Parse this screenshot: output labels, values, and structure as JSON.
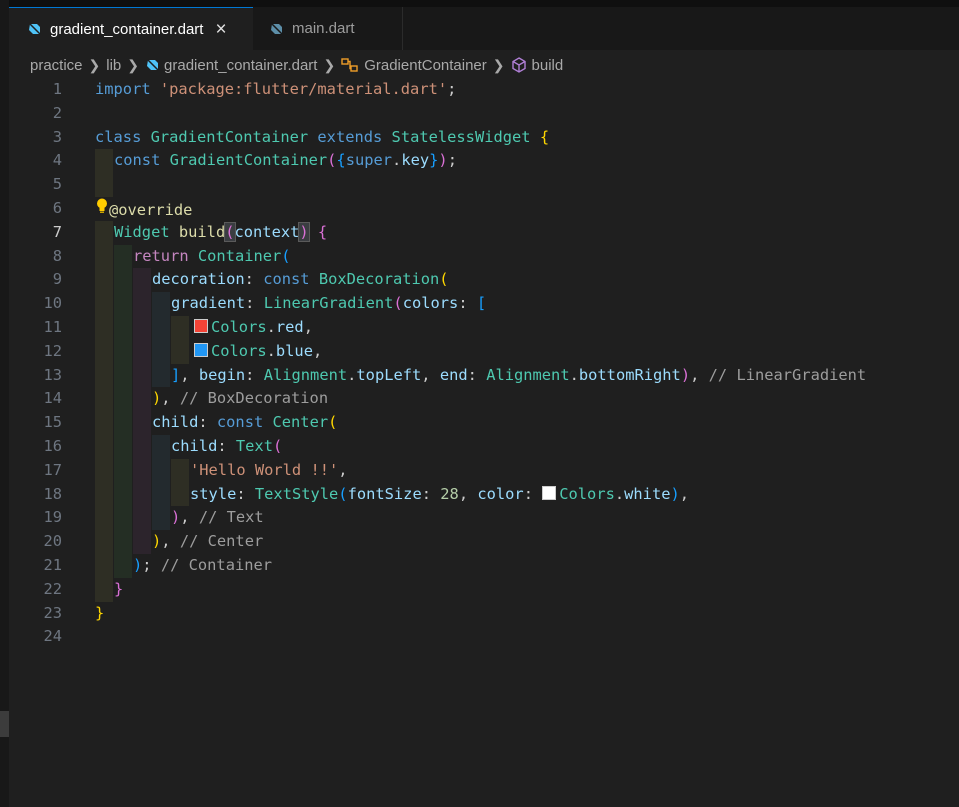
{
  "tabs": [
    {
      "label": "gradient_container.dart",
      "active": true
    },
    {
      "label": "main.dart",
      "active": false
    }
  ],
  "breadcrumb": [
    "practice",
    "lib",
    "gradient_container.dart",
    "GradientContainer",
    "build"
  ],
  "colors": {
    "accent": "#0078d4",
    "red_swatch": "#f44336",
    "blue_swatch": "#2196f3",
    "white_swatch": "#ffffff"
  },
  "lines": {
    "l1": {
      "n": "1",
      "t0": "import ",
      "t1": "'package:flutter/material.dart'",
      "t2": ";"
    },
    "l2": {
      "n": "2"
    },
    "l3": {
      "n": "3",
      "t0": "class ",
      "t1": "GradientContainer ",
      "t2": "extends ",
      "t3": "StatelessWidget ",
      "t4": "{"
    },
    "l4": {
      "n": "4",
      "t0": "const ",
      "t1": "GradientContainer",
      "t2": "(",
      "t3": "{",
      "t4": "super",
      "t5": ".",
      "t6": "key",
      "t7": "}",
      "t8": ")",
      "t9": ";"
    },
    "l5": {
      "n": "5"
    },
    "l6": {
      "n": "6",
      "t0": "@override"
    },
    "l7": {
      "n": "7",
      "t0": "Widget ",
      "t1": "build",
      "t2": "(",
      "t3": "context",
      "t4": ")",
      "t5": " {"
    },
    "l8": {
      "n": "8",
      "t0": "return ",
      "t1": "Container",
      "t2": "("
    },
    "l9": {
      "n": "9",
      "t0": "decoration",
      "t1": ": ",
      "t2": "const ",
      "t3": "BoxDecoration",
      "t4": "("
    },
    "l10": {
      "n": "10",
      "t0": "gradient",
      "t1": ": ",
      "t2": "LinearGradient",
      "t3": "(",
      "t4": "colors",
      "t5": ": ",
      "t6": "["
    },
    "l11": {
      "n": "11",
      "t0": "Colors",
      "t1": ".",
      "t2": "red",
      "t3": ","
    },
    "l12": {
      "n": "12",
      "t0": "Colors",
      "t1": ".",
      "t2": "blue",
      "t3": ","
    },
    "l13": {
      "n": "13",
      "t0": "]",
      "t1": ", ",
      "t2": "begin",
      "t3": ": ",
      "t4": "Alignment",
      "t5": ".",
      "t6": "topLeft",
      "t7": ", ",
      "t8": "end",
      "t9": ": ",
      "t10": "Alignment",
      "t11": ".",
      "t12": "bottomRight",
      "t13": ")",
      "t14": ", ",
      "t15": "// LinearGradient"
    },
    "l14": {
      "n": "14",
      "t0": ")",
      "t1": ", ",
      "t2": "// BoxDecoration"
    },
    "l15": {
      "n": "15",
      "t0": "child",
      "t1": ": ",
      "t2": "const ",
      "t3": "Center",
      "t4": "("
    },
    "l16": {
      "n": "16",
      "t0": "child",
      "t1": ": ",
      "t2": "Text",
      "t3": "("
    },
    "l17": {
      "n": "17",
      "t0": "'Hello World !!'",
      "t1": ","
    },
    "l18": {
      "n": "18",
      "t0": "style",
      "t1": ": ",
      "t2": "TextStyle",
      "t3": "(",
      "t4": "fontSize",
      "t5": ": ",
      "t6": "28",
      "t7": ", ",
      "t8": "color",
      "t9": ": ",
      "t10": "Colors",
      "t11": ".",
      "t12": "white",
      "t13": ")",
      "t14": ","
    },
    "l19": {
      "n": "19",
      "t0": ")",
      "t1": ", ",
      "t2": "// Text"
    },
    "l20": {
      "n": "20",
      "t0": ")",
      "t1": ", ",
      "t2": "// Center"
    },
    "l21": {
      "n": "21",
      "t0": ")",
      "t1": "; ",
      "t2": "// Container"
    },
    "l22": {
      "n": "22",
      "t0": "}"
    },
    "l23": {
      "n": "23",
      "t0": "}"
    },
    "l24": {
      "n": "24"
    }
  }
}
